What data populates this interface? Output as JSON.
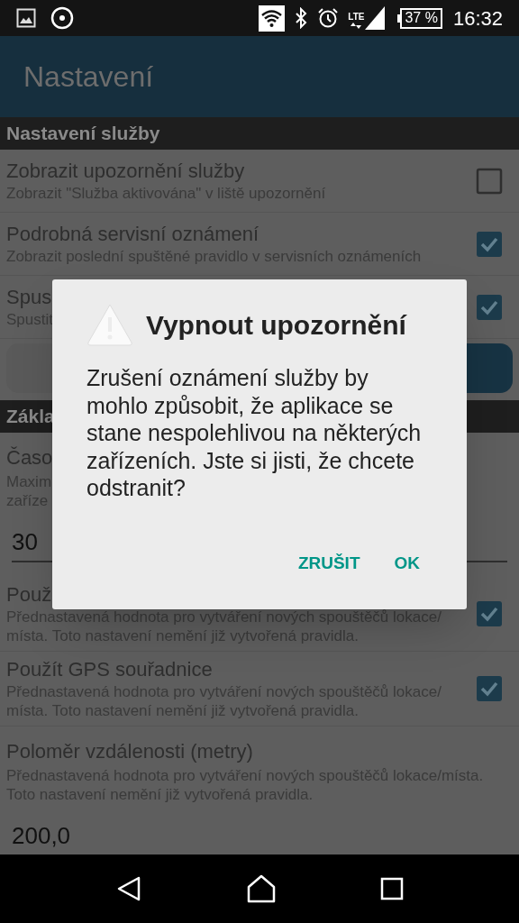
{
  "status_bar": {
    "network": "LTE",
    "battery": "37 %",
    "time": "16:32"
  },
  "app_bar": {
    "title": "Nastavení"
  },
  "sections": [
    {
      "header": "Nastavení služby",
      "items": [
        {
          "kind": "checkbox",
          "title": "Zobrazit upozornění služby",
          "subtitle": "Zobrazit \"Služba aktivována\" v liště upozornění",
          "checked": false
        },
        {
          "kind": "checkbox",
          "title": "Podrobná servisní oznámení",
          "subtitle": "Zobrazit poslední spuštěné pravidlo v servisních oznámeních",
          "checked": true
        },
        {
          "kind": "checkbox",
          "title": "Spus",
          "subtitle": "Spustit",
          "checked": true
        },
        {
          "kind": "button"
        }
      ]
    },
    {
      "header": "Zákla",
      "items": [
        {
          "kind": "text",
          "title": "Časo",
          "subtitle_lines": [
            "Maxim",
            "zaříze"
          ]
        },
        {
          "kind": "input",
          "value": "30"
        },
        {
          "kind": "checkbox",
          "title": "Použ",
          "subtitle": "Přednastavená hodnota pro vytváření nových spouštěčů lokace/ místa. Toto nastavení nemění již vytvořená pravidla.",
          "checked": true
        },
        {
          "kind": "checkbox",
          "title": "Použít GPS souřadnice",
          "subtitle": "Přednastavená hodnota pro vytváření nových spouštěčů lokace/ místa. Toto nastavení nemění již vytvořená pravidla.",
          "checked": true
        },
        {
          "kind": "text",
          "title": "Poloměr vzdálenosti (metry)",
          "subtitle_lines": [
            "Přednastavená hodnota pro vytváření nových spouštěčů lokace/místa.",
            "Toto nastavení nemění již vytvořená pravidla."
          ]
        },
        {
          "kind": "input",
          "value": "200,0"
        }
      ]
    }
  ],
  "dialog": {
    "title": "Vypnout upozornění",
    "message": "Zrušení oznámení služby by mohlo způsobit, že aplikace se stane nespolehlivou na některých zařízeních. Jste si jisti, že chcete odstranit?",
    "buttons": [
      "ZRUŠIT",
      "OK"
    ]
  }
}
